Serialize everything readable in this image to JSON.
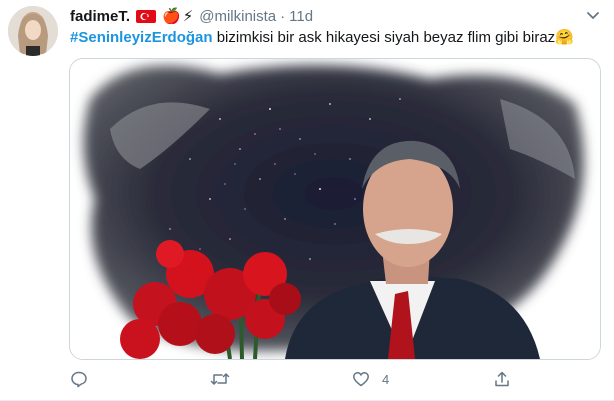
{
  "tweet": {
    "display_name": "fadimeT.",
    "handle": "@milkinista",
    "separator": "·",
    "time": "11d",
    "hashtag": "#SeninleyizErdoğan",
    "body": " bizimkisi bir ask hikayesi siyah beyaz flim gibi biraz",
    "hug_emoji": "🤗",
    "apple_emoji": "🍎",
    "bolt_emoji": "⚡",
    "flag_name": "turkey-flag",
    "actions": {
      "like_count": "4"
    }
  },
  "colors": {
    "hashtag": "#1b95e0",
    "muted": "#657786",
    "flag_red": "#e30a17"
  }
}
